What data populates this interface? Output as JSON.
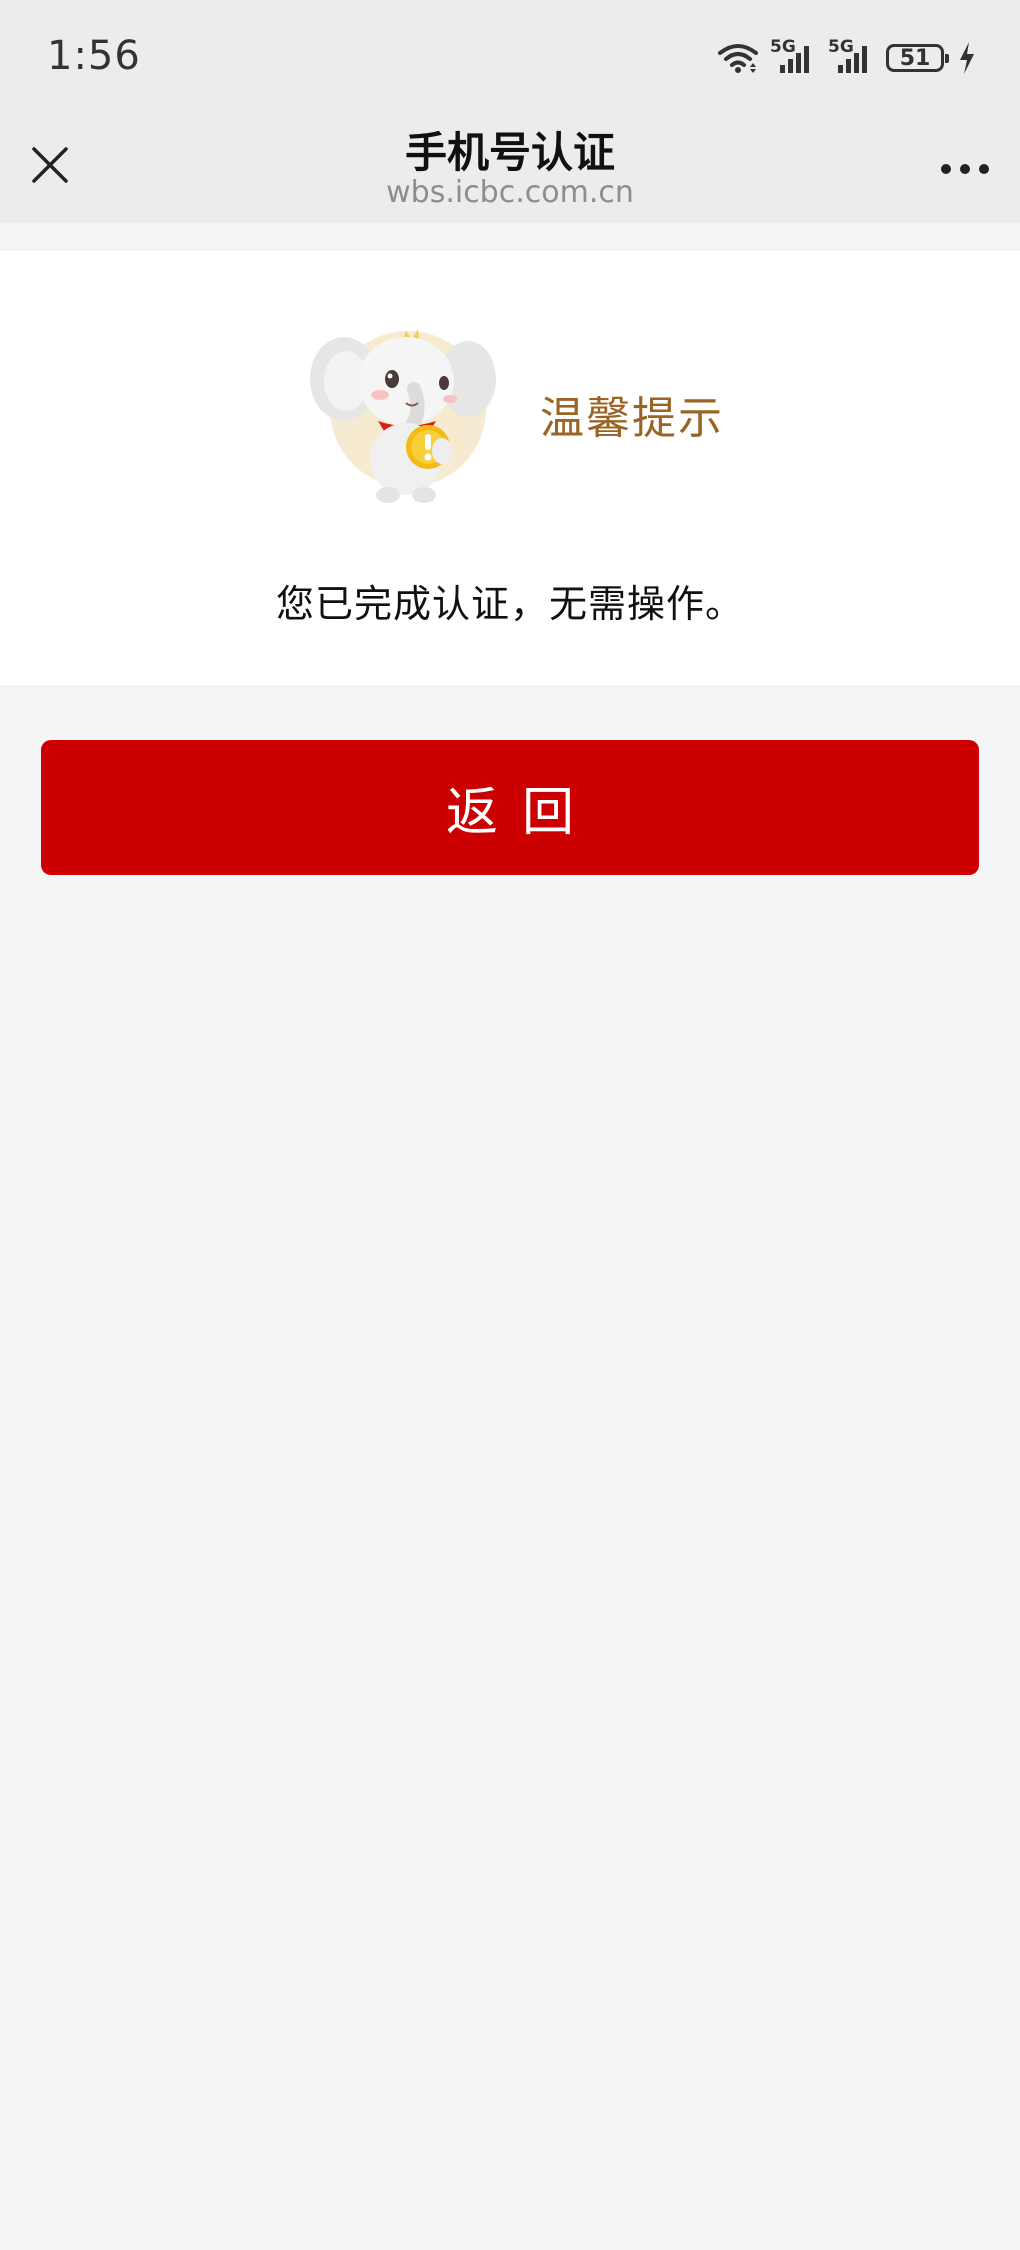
{
  "status_bar": {
    "time": "1:56",
    "network_1": "5G",
    "network_2": "5G",
    "battery": "51"
  },
  "nav": {
    "title": "手机号认证",
    "url": "wbs.icbc.com.cn"
  },
  "notice": {
    "title": "温馨提示",
    "message": "您已完成认证，无需操作。"
  },
  "actions": {
    "back_label": "返回"
  },
  "colors": {
    "accent": "#cc0000",
    "tip_title": "#9b6424",
    "background": "#f4f5f7",
    "nav_bg": "#ececec"
  },
  "icons": {
    "close": "close-icon",
    "more": "more-icon",
    "wifi": "wifi-icon",
    "signal": "signal-icon",
    "charging": "charging-icon",
    "mascot": "elephant-mascot"
  }
}
